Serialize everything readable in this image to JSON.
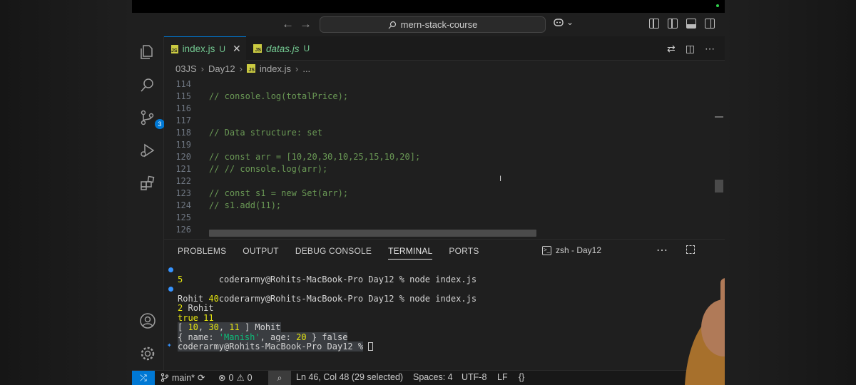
{
  "window": {
    "search_text": "mern-stack-course"
  },
  "tabs": [
    {
      "name": "index.js",
      "status": "U"
    },
    {
      "name": "datas.js",
      "status": "U"
    }
  ],
  "breadcrumb": [
    "03JS",
    "Day12",
    "index.js",
    "..."
  ],
  "activity_bar": {
    "source_control_badge": "3"
  },
  "editor": {
    "lines": [
      {
        "num": "114",
        "code": ""
      },
      {
        "num": "115",
        "code": "// console.log(totalPrice);"
      },
      {
        "num": "116",
        "code": ""
      },
      {
        "num": "117",
        "code": ""
      },
      {
        "num": "118",
        "code": "// Data structure: set"
      },
      {
        "num": "119",
        "code": ""
      },
      {
        "num": "120",
        "code": "// const arr = [10,20,30,10,25,15,10,20];"
      },
      {
        "num": "121",
        "code": "// // console.log(arr);"
      },
      {
        "num": "122",
        "code": ""
      },
      {
        "num": "123",
        "code": "// const s1 = new Set(arr);"
      },
      {
        "num": "124",
        "code": "// s1.add(11);"
      },
      {
        "num": "125",
        "code": ""
      },
      {
        "num": "126",
        "code": ""
      }
    ]
  },
  "panel": {
    "tabs": [
      "PROBLEMS",
      "OUTPUT",
      "DEBUG CONSOLE",
      "TERMINAL",
      "PORTS"
    ],
    "active_tab": "TERMINAL",
    "terminal_name": "zsh - Day12",
    "terminal": {
      "prompt": "coderarmy@Rohits-MacBook-Pro Day12 %",
      "cmd": "node index.js",
      "out1": "5",
      "out2_name": "Rohit",
      "out2_num": "40",
      "out3_num": "2",
      "out3_name": "Rohit",
      "out4_bool": "true",
      "out4_num": "11",
      "out5_open": "[ ",
      "out5_a": "10",
      "out5_b": "30",
      "out5_c": "11",
      "out5_close": " ] Mohit",
      "out6_a": "{ name: ",
      "out6_name": "'Manish'",
      "out6_b": ", age: ",
      "out6_age": "20",
      "out6_c": " } false"
    }
  },
  "statusbar": {
    "branch": "main*",
    "errors": "0",
    "warnings": "0",
    "position": "Ln 46, Col 48 (29 selected)",
    "spaces": "Spaces: 4",
    "encoding": "UTF-8",
    "eol": "LF",
    "language": "{}"
  },
  "colors": {
    "accent": "#0078d4",
    "comment": "#6a9955",
    "terminal_number": "#e5e510",
    "terminal_string": "#0dbc79"
  }
}
